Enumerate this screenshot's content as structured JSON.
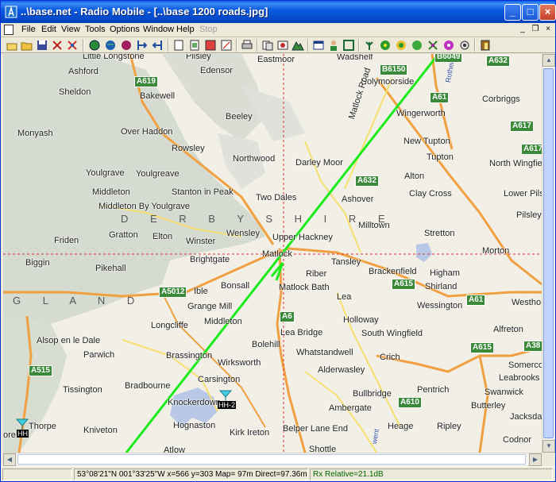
{
  "window": {
    "title": "..\\base.net - Radio Mobile - [..\\base 1200 roads.jpg]"
  },
  "menu": {
    "items": [
      "File",
      "Edit",
      "View",
      "Tools",
      "Options",
      "Window",
      "Help",
      "Stop"
    ]
  },
  "toolbar": {
    "icons": [
      "new-icon",
      "open-icon",
      "save-icon",
      "network-properties-icon",
      "unit-properties-icon",
      "map-properties-icon",
      "world-icon",
      "merge-icon",
      "globe-icon",
      "extract-icon",
      "fit-icon",
      "copy-icon",
      "paste-icon",
      "print-icon",
      "picture-icon",
      "edit-picture-icon",
      "earth-icon",
      "window-icon",
      "users-icon",
      "radio-link-icon",
      "coverage-icon",
      "terrain-icon",
      "settings-icon",
      "info-icon",
      "exit-icon"
    ]
  },
  "map": {
    "labels": [
      {
        "text": "Little Longstone"
      },
      {
        "text": "Pilsley"
      },
      {
        "text": "Eastmoor"
      },
      {
        "text": "Wadshelf"
      },
      {
        "text": "Ashford"
      },
      {
        "text": "Edensor"
      },
      {
        "text": "Holymoorside"
      },
      {
        "text": "Sheldon"
      },
      {
        "text": "Bakewell"
      },
      {
        "text": "Corbriggs"
      },
      {
        "text": "Beeley"
      },
      {
        "text": "Wingerworth"
      },
      {
        "text": "Monyash"
      },
      {
        "text": "Over Haddon"
      },
      {
        "text": "New Tupton"
      },
      {
        "text": "Rowsley"
      },
      {
        "text": "Northwood"
      },
      {
        "text": "Tupton"
      },
      {
        "text": "Youlgrave"
      },
      {
        "text": "Youlgreave"
      },
      {
        "text": "Darley Moor"
      },
      {
        "text": "North Wingfield"
      },
      {
        "text": "Alton"
      },
      {
        "text": "Middleton"
      },
      {
        "text": "Stanton in Peak"
      },
      {
        "text": "Two Dales"
      },
      {
        "text": "Ashover"
      },
      {
        "text": "Clay Cross"
      },
      {
        "text": "Lower Pilsley"
      },
      {
        "text": "Middleton By Youlgrave"
      },
      {
        "text": "Pilsley"
      },
      {
        "text": "Gratton"
      },
      {
        "text": "Elton"
      },
      {
        "text": "Wensley"
      },
      {
        "text": "Milltown"
      },
      {
        "text": "Stretton"
      },
      {
        "text": "Friden"
      },
      {
        "text": "Winster"
      },
      {
        "text": "Upper Hackney"
      },
      {
        "text": "Biggin"
      },
      {
        "text": "Brightgate"
      },
      {
        "text": "Matlock"
      },
      {
        "text": "Tansley"
      },
      {
        "text": "Morton"
      },
      {
        "text": "Pikehall"
      },
      {
        "text": "Riber"
      },
      {
        "text": "Brackenfield"
      },
      {
        "text": "Higham"
      },
      {
        "text": "Bonsall"
      },
      {
        "text": "Matlock Bath"
      },
      {
        "text": "Shirland"
      },
      {
        "text": "Ible"
      },
      {
        "text": "Grange Mill"
      },
      {
        "text": "Lea"
      },
      {
        "text": "Wessington"
      },
      {
        "text": "Westho"
      },
      {
        "text": "Longcliffe"
      },
      {
        "text": "Middleton"
      },
      {
        "text": "Holloway"
      },
      {
        "text": "Alfreton"
      },
      {
        "text": "Alsop en le Dale"
      },
      {
        "text": "Lea Bridge"
      },
      {
        "text": "South Wingfield"
      },
      {
        "text": "Parwich"
      },
      {
        "text": "Brassington"
      },
      {
        "text": "Bolehill"
      },
      {
        "text": "Whatstandwell"
      },
      {
        "text": "Crich"
      },
      {
        "text": "Somerco"
      },
      {
        "text": "Wirksworth"
      },
      {
        "text": "Alderwasley"
      },
      {
        "text": "Leabrooks"
      },
      {
        "text": "Carsington"
      },
      {
        "text": "Tissington"
      },
      {
        "text": "Bradbourne"
      },
      {
        "text": "Pentrich"
      },
      {
        "text": "Swanwick"
      },
      {
        "text": "Knockerdown"
      },
      {
        "text": "Bullbridge"
      },
      {
        "text": "Butterley"
      },
      {
        "text": "Ambergate"
      },
      {
        "text": "Jacksda"
      },
      {
        "text": "Thorpe"
      },
      {
        "text": "Hognaston"
      },
      {
        "text": "Heage"
      },
      {
        "text": "Ripley"
      },
      {
        "text": "Kniveton"
      },
      {
        "text": "Kirk Ireton"
      },
      {
        "text": "Belper Lane End"
      },
      {
        "text": "Codnor"
      },
      {
        "text": "Shottle"
      },
      {
        "text": "Atlow"
      },
      {
        "text": "ore"
      },
      {
        "text": "Matlock Road"
      },
      {
        "text": "Rother"
      },
      {
        "text": "went"
      }
    ],
    "roads": [
      {
        "text": "A619"
      },
      {
        "text": "B6150"
      },
      {
        "text": "A632"
      },
      {
        "text": "A61"
      },
      {
        "text": "A617"
      },
      {
        "text": "A617"
      },
      {
        "text": "A632"
      },
      {
        "text": "A615"
      },
      {
        "text": "A5012"
      },
      {
        "text": "A6"
      },
      {
        "text": "A61"
      },
      {
        "text": "A615"
      },
      {
        "text": "A38"
      },
      {
        "text": "A515"
      },
      {
        "text": "A610"
      },
      {
        "text": "B6049"
      }
    ],
    "regions": [
      "D E R B Y S H I R E",
      "G L A N D"
    ],
    "units": [
      {
        "name": "HH-2"
      },
      {
        "name": "HH"
      }
    ]
  },
  "statusbar": {
    "coords": "53°08'21\"N  001°33'25\"W  x=566 y=303 Map= 97m Direct=97.36m SR",
    "rx": "Rx Relative=21.1dB"
  },
  "colors": {
    "link_line": "#1aeb1a",
    "rx_text": "#006400",
    "hill": "#d2d8cc"
  }
}
